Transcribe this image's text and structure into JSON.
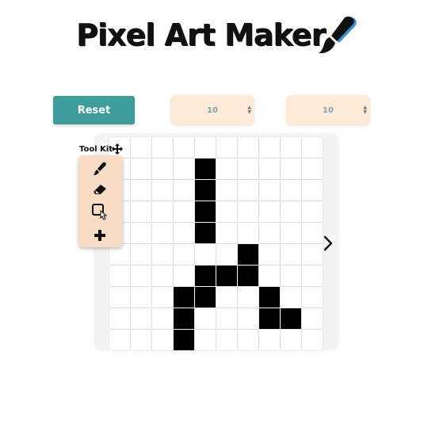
{
  "app": {
    "title": "Pixel Art Maker",
    "title_icon": "paintbrush-icon"
  },
  "controls": {
    "reset_label": "Reset",
    "rows_value": "10",
    "cols_value": "10",
    "spinner_icon": "spinner-arrows-icon"
  },
  "toolkit": {
    "title": "Tool Kit",
    "move_icon": "move-arrows-icon",
    "tools": [
      "brush-icon",
      "eraser-icon",
      "rectangle-icon",
      "plus-icon"
    ]
  },
  "canvas": {
    "rows": 10,
    "cols": 10,
    "fill_color": "#000000",
    "empty_color": "#ffffff",
    "filled_cells": [
      [
        1,
        4
      ],
      [
        2,
        4
      ],
      [
        3,
        4
      ],
      [
        4,
        4
      ],
      [
        5,
        6
      ],
      [
        6,
        4
      ],
      [
        6,
        5
      ],
      [
        6,
        6
      ],
      [
        7,
        3
      ],
      [
        7,
        4
      ],
      [
        7,
        7
      ],
      [
        8,
        3
      ],
      [
        8,
        7
      ],
      [
        8,
        8
      ],
      [
        9,
        3
      ]
    ]
  },
  "nav": {
    "next_icon": "chevron-right-icon"
  },
  "colors": {
    "accent": "#3e9d9a",
    "panel": "#fdebd8",
    "toolkit_bg": "#f6dcc4"
  }
}
